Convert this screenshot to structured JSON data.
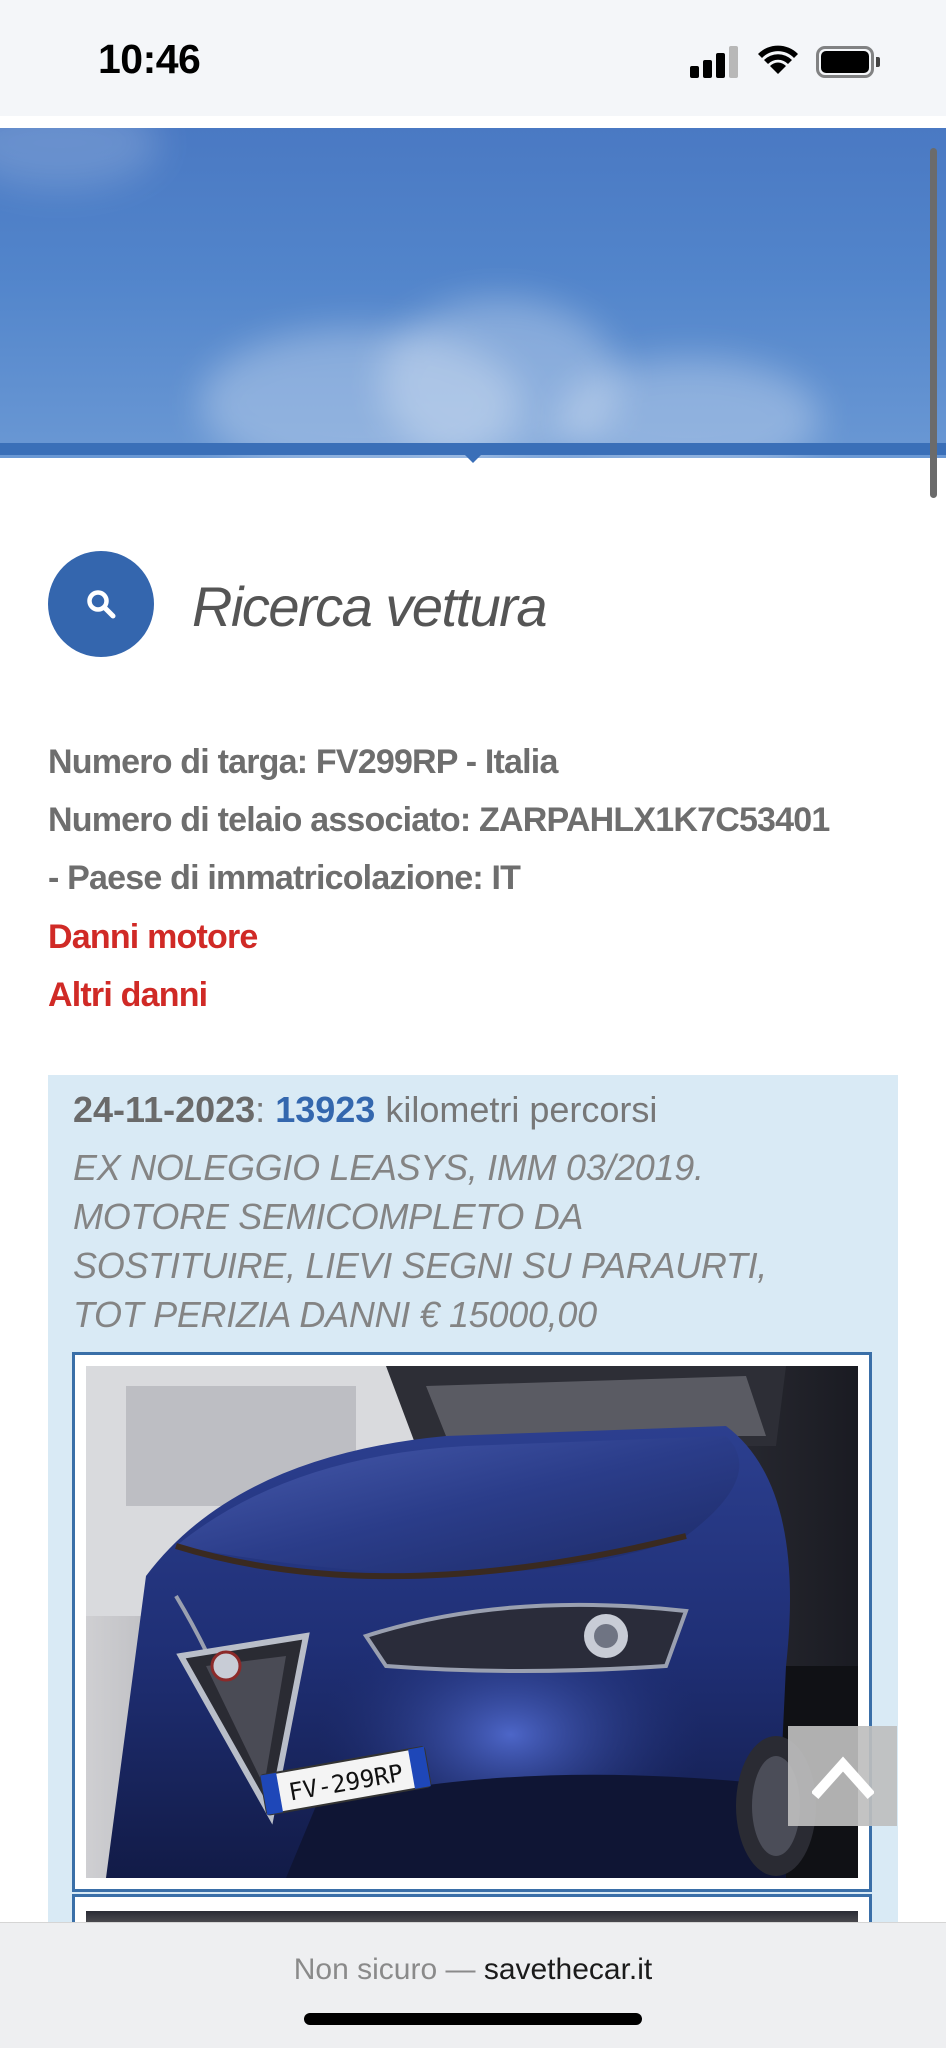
{
  "status_bar": {
    "time": "10:46",
    "icons": [
      "signal-icon",
      "wifi-icon",
      "battery-icon"
    ]
  },
  "page": {
    "title": "Ricerca vettura",
    "title_icon": "search-icon",
    "info_lines": [
      "Numero di targa: FV299RP - Italia",
      "Numero di telaio associato: ZARPAHLX1K7C53401",
      "- Paese di immatricolazione: IT"
    ],
    "damage_links": [
      "Danni motore",
      "Altri danni"
    ]
  },
  "record": {
    "date": "24-11-2023",
    "date_separator": ":",
    "km": "13923",
    "km_label": "kilometri percorsi",
    "note_lines": [
      "EX NOLEGGIO LEASYS, IMM 03/2019.",
      "MOTORE SEMICOMPLETO DA",
      "SOSTITUIRE, LIEVI SEGNI SU PARAURTI,",
      "TOT PERIZIA DANNI € 15000,00"
    ],
    "photo_plate": "FV-299RP"
  },
  "browser": {
    "security_label": "Non sicuro —",
    "domain": "savethecar.it"
  },
  "colors": {
    "accent": "#3466ae",
    "danger": "#d02a26",
    "record_bg": "#d9eaf5",
    "hero": "#4a79c3"
  }
}
